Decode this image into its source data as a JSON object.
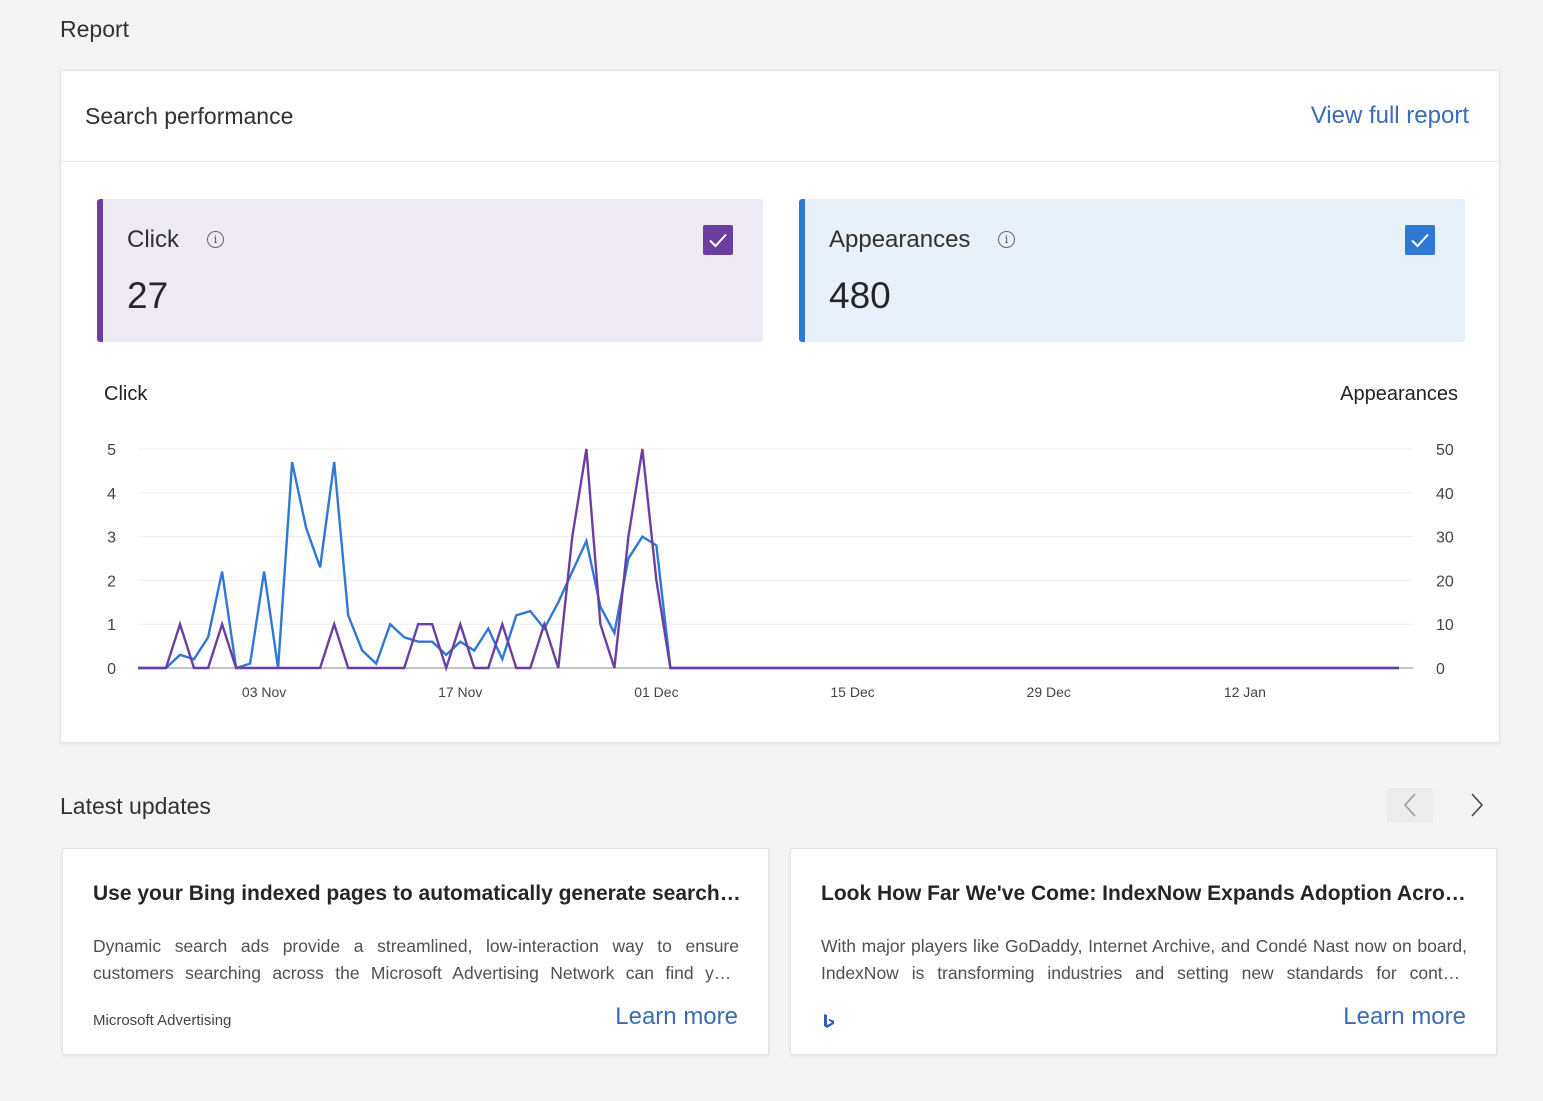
{
  "page_title": "Report",
  "performance": {
    "title": "Search performance",
    "view_full_report": "View full report",
    "metrics": {
      "click": {
        "label": "Click",
        "value": "27",
        "checked": true,
        "color": "#6b3fa0"
      },
      "appearances": {
        "label": "Appearances",
        "value": "480",
        "checked": true,
        "color": "#2f78d3"
      }
    }
  },
  "chart_data": {
    "type": "line",
    "left_axis_label": "Click",
    "right_axis_label": "Appearances",
    "left_ticks": [
      "0",
      "1",
      "2",
      "3",
      "4",
      "5"
    ],
    "right_ticks": [
      "0",
      "10",
      "20",
      "30",
      "40",
      "50"
    ],
    "left_range": [
      0,
      5
    ],
    "right_range": [
      0,
      50
    ],
    "x_tick_labels": [
      "03 Nov",
      "17 Nov",
      "01 Dec",
      "15 Dec",
      "29 Dec",
      "12 Jan"
    ],
    "x_tick_day_index": [
      9,
      23,
      37,
      51,
      65,
      79
    ],
    "num_days": 91,
    "grid": true,
    "series": [
      {
        "name": "Appearances",
        "axis": "right",
        "color": "#2f78d3",
        "values": [
          0,
          0,
          0,
          3,
          2,
          7,
          22,
          0,
          1,
          22,
          0,
          47,
          32,
          23,
          47,
          12,
          4,
          1,
          10,
          7,
          6,
          6,
          3,
          6,
          4,
          9,
          2,
          12,
          13,
          9,
          15,
          22,
          29,
          14,
          8,
          25,
          30,
          28,
          0,
          0,
          0,
          0,
          0,
          0,
          0,
          0,
          0,
          0,
          0,
          0,
          0,
          0,
          0,
          0,
          0,
          0,
          0,
          0,
          0,
          0,
          0,
          0,
          0,
          0,
          0,
          0,
          0,
          0,
          0,
          0,
          0,
          0,
          0,
          0,
          0,
          0,
          0,
          0,
          0,
          0,
          0,
          0,
          0,
          0,
          0,
          0,
          0,
          0,
          0,
          0,
          0
        ]
      },
      {
        "name": "Click",
        "axis": "left",
        "color": "#6b3fa0",
        "values": [
          0,
          0,
          0,
          1,
          0,
          0,
          1,
          0,
          0,
          0,
          0,
          0,
          0,
          0,
          1,
          0,
          0,
          0,
          0,
          0,
          1,
          1,
          0,
          1,
          0,
          0,
          1,
          0,
          0,
          1,
          0,
          3,
          5,
          1,
          0,
          3,
          5,
          2,
          0,
          0,
          0,
          0,
          0,
          0,
          0,
          0,
          0,
          0,
          0,
          0,
          0,
          0,
          0,
          0,
          0,
          0,
          0,
          0,
          0,
          0,
          0,
          0,
          0,
          0,
          0,
          0,
          0,
          0,
          0,
          0,
          0,
          0,
          0,
          0,
          0,
          0,
          0,
          0,
          0,
          0,
          0,
          0,
          0,
          0,
          0,
          0,
          0,
          0,
          0,
          0,
          0
        ]
      }
    ]
  },
  "updates": {
    "title": "Latest updates",
    "cards": [
      {
        "title": "Use your Bing indexed pages to automatically generate search ads",
        "description": "Dynamic search ads provide a streamlined, low-interaction way to ensure customers searching across the Microsoft Advertising Network can find your business and products quickly and easily.",
        "source": "Microsoft Advertising",
        "learn_more": "Learn more"
      },
      {
        "title": "Look How Far We've Come: IndexNow Expands Adoption Across Industries",
        "description": "With major players like GoDaddy, Internet Archive, and Condé Nast now on board, IndexNow is transforming industries and setting new standards for content discovery.",
        "source_icon": "bing-icon",
        "learn_more": "Learn more"
      }
    ]
  }
}
